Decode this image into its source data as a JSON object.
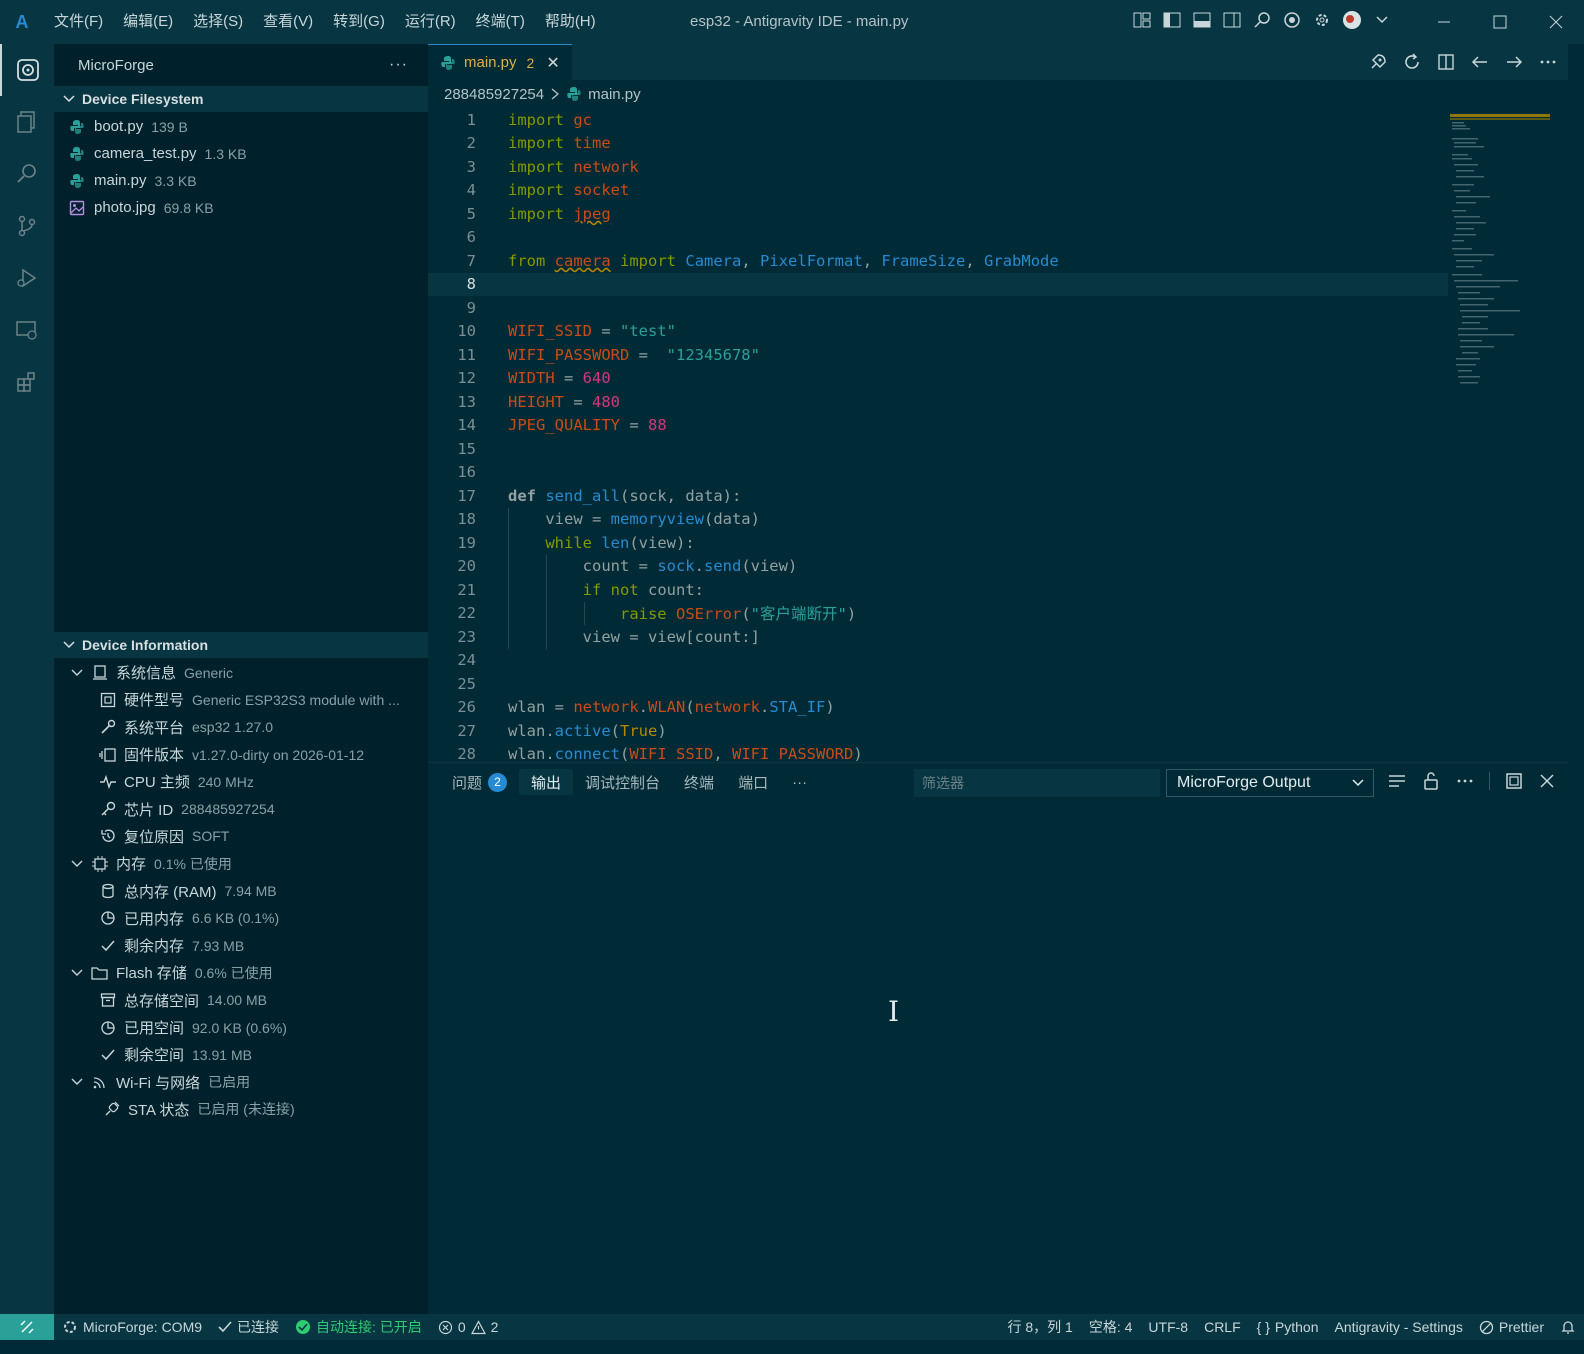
{
  "titlebar": {
    "logo": "A",
    "menu": [
      "文件(F)",
      "编辑(E)",
      "选择(S)",
      "查看(V)",
      "转到(G)",
      "运行(R)",
      "终端(T)",
      "帮助(H)"
    ],
    "window_title": "esp32 - Antigravity IDE - main.py"
  },
  "sidebar": {
    "title": "MicroForge",
    "more": "···",
    "filesystem_header": "Device Filesystem",
    "files": [
      {
        "name": "boot.py",
        "size": "139 B",
        "icon": "python-icon"
      },
      {
        "name": "camera_test.py",
        "size": "1.3 KB",
        "icon": "python-icon"
      },
      {
        "name": "main.py",
        "size": "3.3 KB",
        "icon": "python-icon"
      },
      {
        "name": "photo.jpg",
        "size": "69.8 KB",
        "icon": "image-icon"
      }
    ],
    "info_header": "Device Information",
    "info": {
      "system": {
        "label": "系统信息",
        "value": "Generic"
      },
      "hw_model": {
        "label": "硬件型号",
        "value": "Generic ESP32S3 module with ..."
      },
      "platform": {
        "label": "系统平台",
        "value": "esp32 1.27.0"
      },
      "firmware": {
        "label": "固件版本",
        "value": "v1.27.0-dirty on 2026-01-12"
      },
      "cpu": {
        "label": "CPU 主频",
        "value": "240 MHz"
      },
      "chip_id": {
        "label": "芯片 ID",
        "value": "288485927254"
      },
      "reset": {
        "label": "复位原因",
        "value": "SOFT"
      },
      "memory": {
        "label": "内存",
        "value": "0.1% 已使用"
      },
      "ram_total": {
        "label": "总内存 (RAM)",
        "value": "7.94 MB"
      },
      "ram_used": {
        "label": "已用内存",
        "value": "6.6 KB (0.1%)"
      },
      "ram_free": {
        "label": "剩余内存",
        "value": "7.93 MB"
      },
      "flash": {
        "label": "Flash 存储",
        "value": "0.6% 已使用"
      },
      "flash_total": {
        "label": "总存储空间",
        "value": "14.00 MB"
      },
      "flash_used": {
        "label": "已用空间",
        "value": "92.0 KB (0.6%)"
      },
      "flash_free": {
        "label": "剩余空间",
        "value": "13.91 MB"
      },
      "wifi": {
        "label": "Wi-Fi 与网络",
        "value": "已启用"
      },
      "sta": {
        "label": "STA 状态",
        "value": "已启用 (未连接)"
      }
    }
  },
  "editor": {
    "tab": {
      "label": "main.py",
      "problems": "2",
      "close": "✕"
    },
    "breadcrumb": {
      "folder": "288485927254",
      "file": "main.py"
    },
    "line_numbers": [
      "1",
      "2",
      "3",
      "4",
      "5",
      "6",
      "7",
      "8",
      "9",
      "10",
      "11",
      "12",
      "13",
      "14",
      "15",
      "16",
      "17",
      "18",
      "19",
      "20",
      "21",
      "22",
      "23",
      "24",
      "25",
      "26",
      "27",
      "28"
    ]
  },
  "panel": {
    "tabs": [
      "问题",
      "输出",
      "调试控制台",
      "终端",
      "端口",
      "···"
    ],
    "problems_count": "2",
    "filter_placeholder": "筛选器",
    "output_channel": "MicroForge Output"
  },
  "statusbar": {
    "port": "MicroForge: COM9",
    "connected": "已连接",
    "auto_connect": "自动连接: 已开启",
    "errors": "0",
    "warnings": "2",
    "position": "行 8，列 1",
    "spaces": "空格: 4",
    "encoding": "UTF-8",
    "eol": "CRLF",
    "language": "Python",
    "settings": "Antigravity - Settings",
    "prettier": "Prettier"
  },
  "colors": {
    "background": "#002b36",
    "panel": "#073642",
    "accent": "#268bd2",
    "keyword": "#859900",
    "module": "#cb4b16",
    "string": "#2aa198",
    "number": "#d33682"
  }
}
